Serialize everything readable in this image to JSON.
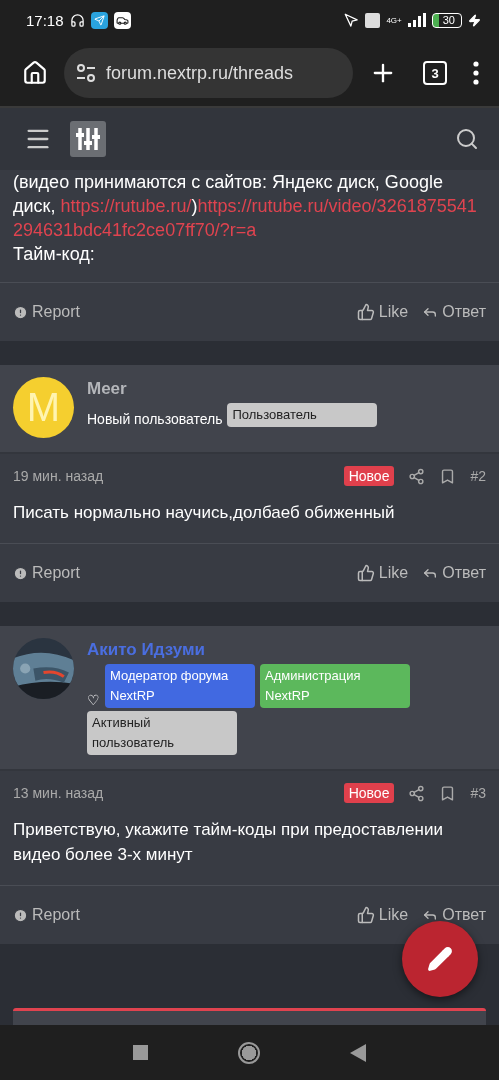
{
  "status_bar": {
    "time": "17:18",
    "network": "4G+",
    "battery": "30"
  },
  "browser": {
    "url": "forum.nextrp.ru/threads",
    "tab_count": "3"
  },
  "posts": [
    {
      "kind": "tail",
      "body": [
        {
          "kind": "text",
          "text": "(видео принимаются с сайтов: Яндекс диск, Google диск, "
        },
        {
          "kind": "link",
          "text": "https://rutube.ru/"
        },
        {
          "kind": "text",
          "text": ")"
        },
        {
          "kind": "link",
          "text": "https://rutube.ru/video/3261875541294631bdc41fc2ce07ff70/?r=a"
        }
      ],
      "body_end": "Тайм-код:",
      "actions": [
        {
          "kind": "report",
          "label": "Report"
        },
        {
          "kind": "like",
          "label": "Like"
        },
        {
          "kind": "reply",
          "label": "Ответ"
        }
      ]
    },
    {
      "kind": "full",
      "author": {
        "name": "Meer",
        "color": "#b4b6ba",
        "avatar": {
          "kind": "letter",
          "letter": "M",
          "color": "#f5cf2f"
        },
        "title": "Новый пользователь",
        "badges": [
          {
            "text": "Пользователь",
            "color": "#c8c8c8"
          }
        ]
      },
      "time": "19 мин. назад",
      "new_badge": "Новое",
      "number": "#2",
      "body_text": "Писать нормально научись,долбаеб обиженный",
      "actions": [
        {
          "kind": "report",
          "label": "Report"
        },
        {
          "kind": "like",
          "label": "Like"
        },
        {
          "kind": "reply",
          "label": "Ответ"
        }
      ]
    },
    {
      "kind": "full",
      "author": {
        "name": "Акито Идзуми",
        "color": "#4a6ee0",
        "title": "♡",
        "badges": [
          {
            "text": "Модератор форума NextRP",
            "color": "#4169e1"
          },
          {
            "text": "Администрация NextRP",
            "color": "#5cb85c"
          },
          {
            "text": "Активный пользователь",
            "color": "#c8c8c8"
          }
        ]
      },
      "time": "13 мин. назад",
      "new_badge": "Новое",
      "number": "#3",
      "body_text": "Приветствую, укажите тайм-коды при предоставлении видео более 3-х минут",
      "actions": [
        {
          "kind": "report",
          "label": "Report"
        },
        {
          "kind": "like",
          "label": "Like"
        },
        {
          "kind": "reply",
          "label": "Ответ"
        }
      ]
    }
  ]
}
